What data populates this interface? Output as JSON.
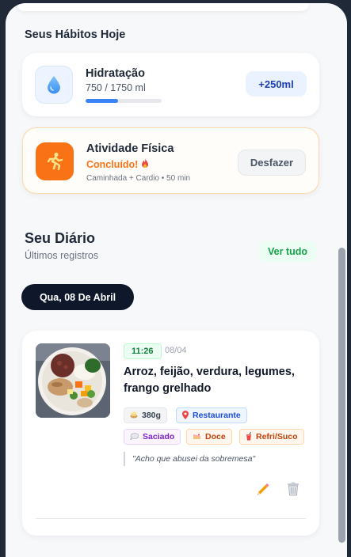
{
  "habits": {
    "section_title": "Seus Hábitos Hoje",
    "hydration": {
      "icon": "water-drop-icon",
      "title": "Hidratação",
      "value": "750 / 1750 ml",
      "progress_fraction": 0.43,
      "add_button": "+250ml"
    },
    "activity": {
      "icon": "running-person-icon",
      "title": "Atividade Física",
      "status": "Concluído!",
      "status_icon": "fire-icon",
      "detail": "Caminhada + Cardio • 50 min",
      "undo_button": "Desfazer",
      "accent_color": "#f97316"
    }
  },
  "diary": {
    "title": "Seu Diário",
    "subtitle": "Últimos registros",
    "see_all": "Ver tudo",
    "date_pill": "Qua, 08 De Abril",
    "entry": {
      "time": "11:26",
      "date": "08/04",
      "title": "Arroz, feijão, verdura, legumes, frango grelhado",
      "tags": {
        "weight": "380g",
        "place": "Restaurante",
        "satiety": "Saciado",
        "dessert": "Doce",
        "drink": "Refri/Suco"
      },
      "note": "\"Acho que abusei da sobremesa\"",
      "edit_icon": "pencil-icon",
      "delete_icon": "trash-icon"
    }
  }
}
